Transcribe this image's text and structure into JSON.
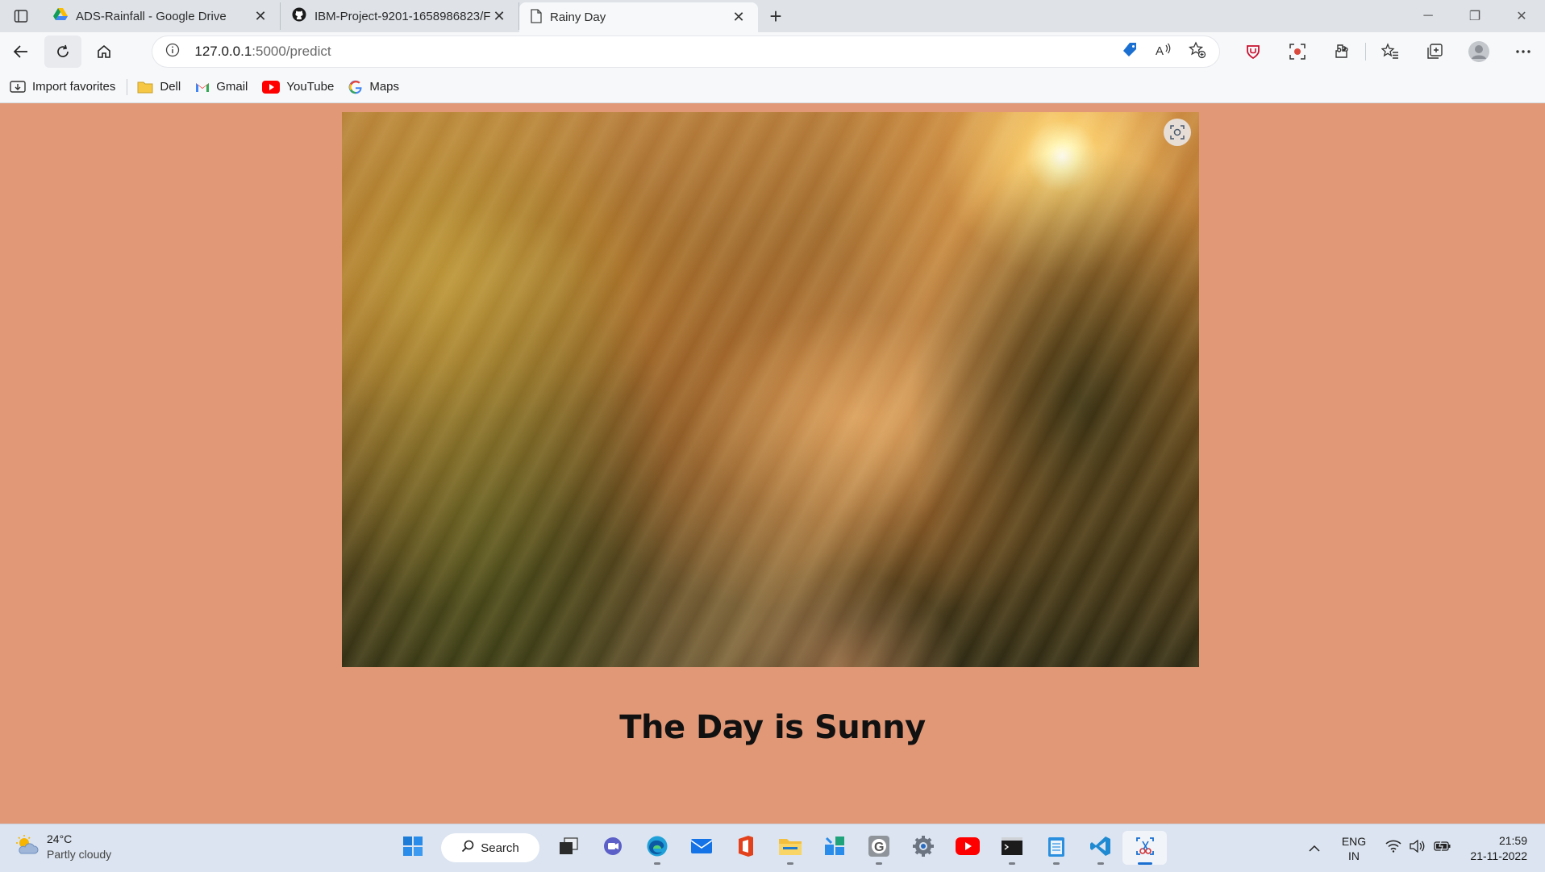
{
  "browser": {
    "tabs": [
      {
        "title": "ADS-Rainfall - Google Drive",
        "icon": "google-drive-icon",
        "active": false
      },
      {
        "title": "IBM-Project-9201-1658986823/F",
        "icon": "github-icon",
        "active": false
      },
      {
        "title": "Rainy Day",
        "icon": "page-icon",
        "active": true
      }
    ],
    "address": {
      "host": "127.0.0.1",
      "path": ":5000/predict"
    },
    "favorites": [
      {
        "label": "Import favorites",
        "icon": "import-icon"
      },
      {
        "label": "Dell",
        "icon": "folder-icon"
      },
      {
        "label": "Gmail",
        "icon": "gmail-icon"
      },
      {
        "label": "YouTube",
        "icon": "youtube-icon"
      },
      {
        "label": "Maps",
        "icon": "google-icon"
      }
    ]
  },
  "page": {
    "image_alt": "",
    "result": "The Day is Sunny"
  },
  "taskbar": {
    "weather": {
      "temp": "24°C",
      "condition": "Partly cloudy"
    },
    "search_label": "Search",
    "language": {
      "lang": "ENG",
      "region": "IN"
    },
    "clock": {
      "time": "21:59",
      "date": "21-11-2022"
    }
  },
  "colors": {
    "page_background": "#e19877",
    "taskbar_accent": "#1a6fd1"
  }
}
